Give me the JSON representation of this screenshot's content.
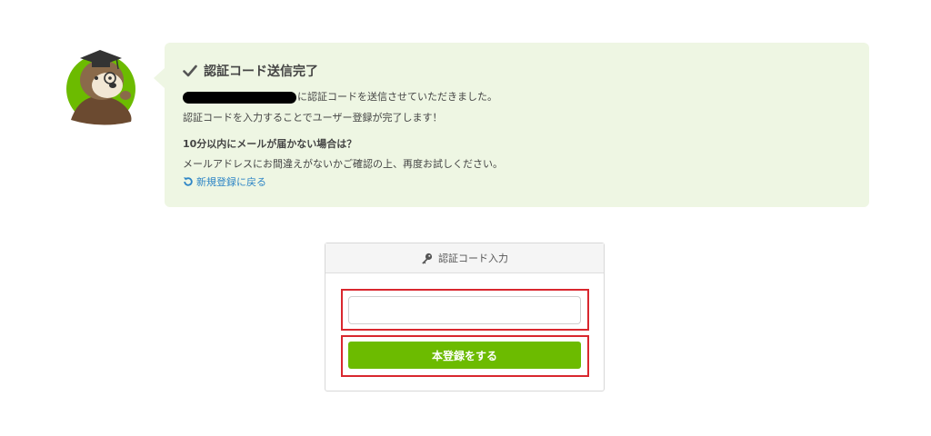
{
  "notice": {
    "title": "認証コード送信完了",
    "line1_suffix": "に認証コードを送信させていただきました。",
    "line2": "認証コードを入力することでユーザー登録が完了します！",
    "not_received_heading": "10分以内にメールが届かない場合は？",
    "not_received_body": "メールアドレスにお間違えがないかご確認の上、再度お試しください。",
    "back_link": "新規登録に戻る"
  },
  "form": {
    "header": "認証コード入力",
    "code_value": "",
    "submit_label": "本登録をする"
  },
  "colors": {
    "bubble_bg": "#eef6e3",
    "link": "#2f86c6",
    "primary_button": "#6cbb00",
    "highlight": "#d9272e"
  },
  "icons": {
    "title": "check-icon",
    "back_link": "refresh-icon",
    "form_header": "key-icon",
    "avatar": "otter-mascot"
  }
}
